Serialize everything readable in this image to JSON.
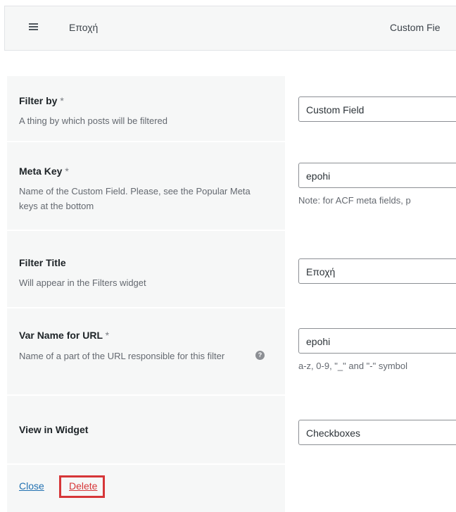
{
  "topbar": {
    "menu_icon": "hamburger-icon",
    "title": "Εποχή",
    "type": "Custom Fie"
  },
  "fields": [
    {
      "label": "Filter by",
      "required_mark": "*",
      "description": "A thing by which posts will be filtered",
      "value": "Custom Field",
      "note": ""
    },
    {
      "label": "Meta Key",
      "required_mark": "*",
      "description": "Name of the Custom Field. Please, see the Popular Meta keys at the bottom",
      "value": "epohi",
      "note": "Note: for ACF meta fields, p"
    },
    {
      "label": "Filter Title",
      "required_mark": "",
      "description": "Will appear in the Filters widget",
      "value": "Εποχή",
      "note": ""
    },
    {
      "label": "Var Name for URL",
      "required_mark": "*",
      "description": "Name of a part of the URL responsible for this filter",
      "help_icon": "question-circle-icon",
      "help_glyph": "?",
      "value": "epohi",
      "note": "a-z, 0-9, \"_\" and \"-\" symbol"
    },
    {
      "label": "View in Widget",
      "required_mark": "",
      "description": "",
      "value": "Checkboxes",
      "note": ""
    }
  ],
  "footer": {
    "close_label": "Close",
    "delete_label": "Delete"
  },
  "colors": {
    "panel_bg": "#f6f7f7",
    "link": "#2271b1",
    "delete": "#d63638",
    "highlight_border": "#d63638"
  }
}
